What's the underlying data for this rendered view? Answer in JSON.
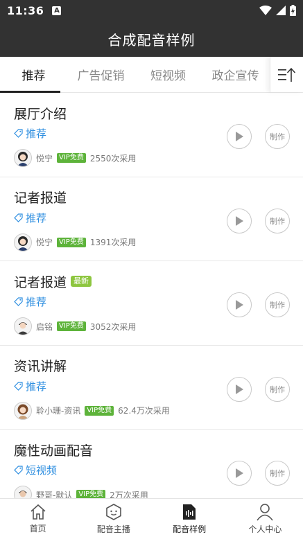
{
  "status": {
    "time": "11:36",
    "notice_glyph": "A"
  },
  "title": "合成配音样例",
  "tabs": [
    {
      "label": "推荐"
    },
    {
      "label": "广告促销"
    },
    {
      "label": "短视频"
    },
    {
      "label": "政企宣传"
    }
  ],
  "items": [
    {
      "title": "展厅介绍",
      "badge": "",
      "tag": "推荐",
      "voice": "悦宁",
      "vip": "VIP免费",
      "uses": "2550次采用",
      "play_icon": "play-icon",
      "make_label": "制作"
    },
    {
      "title": "记者报道",
      "badge": "",
      "tag": "推荐",
      "voice": "悦宁",
      "vip": "VIP免费",
      "uses": "1391次采用",
      "play_icon": "play-icon",
      "make_label": "制作"
    },
    {
      "title": "记者报道",
      "badge": "最新",
      "tag": "推荐",
      "voice": "启铭",
      "vip": "VIP免费",
      "uses": "3052次采用",
      "play_icon": "play-icon",
      "make_label": "制作"
    },
    {
      "title": "资讯讲解",
      "badge": "",
      "tag": "推荐",
      "voice": "聆小珊-资讯",
      "vip": "VIP免费",
      "uses": "62.4万次采用",
      "play_icon": "play-icon",
      "make_label": "制作"
    },
    {
      "title": "魔性动画配音",
      "badge": "",
      "tag": "短视频",
      "voice": "野哥-默认",
      "vip": "VIP免费",
      "uses": "2万次采用",
      "play_icon": "play-icon",
      "make_label": "制作"
    }
  ],
  "nav": [
    {
      "label": "首页",
      "icon": "home-icon"
    },
    {
      "label": "配音主播",
      "icon": "anchor-icon"
    },
    {
      "label": "配音样例",
      "icon": "sample-icon"
    },
    {
      "label": "个人中心",
      "icon": "user-icon"
    }
  ],
  "colors": {
    "header_bg": "#323232",
    "tag_blue": "#2f8fe0",
    "vip_green": "#5db33a",
    "new_green": "#8dc63f"
  }
}
